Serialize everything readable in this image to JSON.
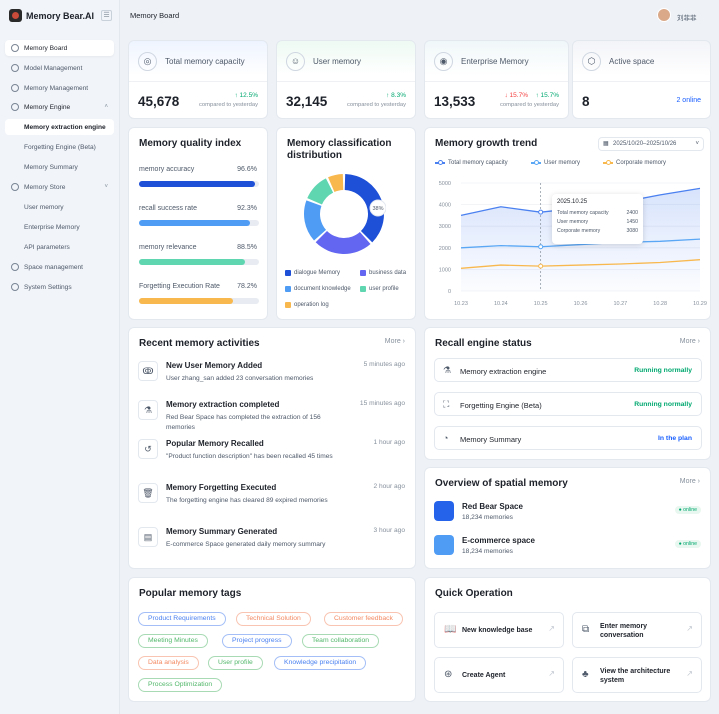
{
  "app": {
    "name": "Memory Bear.AI",
    "page_title": "Memory Board",
    "user": "刘菲菲"
  },
  "sidebar": {
    "items": [
      {
        "label": "Memory Board"
      },
      {
        "label": "Model Management"
      },
      {
        "label": "Memory Management"
      },
      {
        "label": "Memory Engine"
      },
      {
        "label": "Memory extraction engine"
      },
      {
        "label": "Forgetting Engine (Beta)"
      },
      {
        "label": "Memory Summary"
      },
      {
        "label": "Memory Store"
      },
      {
        "label": "User memory"
      },
      {
        "label": "Enterprise Memory"
      },
      {
        "label": "API parameters"
      },
      {
        "label": "Space management"
      },
      {
        "label": "System Settings"
      }
    ]
  },
  "stats": [
    {
      "label": "Total memory capacity",
      "value": "45,678",
      "delta": "↑ 12.5%",
      "compare": "compared to yesterday"
    },
    {
      "label": "User memory",
      "value": "32,145",
      "delta": "↑ 8.3%",
      "compare": "compared to yesterday"
    },
    {
      "label": "Enterprise Memory",
      "value": "13,533",
      "delta_down": "↓ 15.7%",
      "delta_up": "↑ 15.7%",
      "compare": "compared to yesterday"
    },
    {
      "label": "Active space",
      "value": "8",
      "online": "2 online"
    }
  ],
  "quality": {
    "title": "Memory quality index",
    "items": [
      {
        "label": "memory accuracy",
        "value": "96.6%",
        "pct": 96.6,
        "color": "#1d4fd7"
      },
      {
        "label": "recall success rate",
        "value": "92.3%",
        "pct": 92.3,
        "color": "#4f9cf5"
      },
      {
        "label": "memory relevance",
        "value": "88.5%",
        "pct": 88.5,
        "color": "#5fd5b0"
      },
      {
        "label": "Forgetting Execution Rate",
        "value": "78.2%",
        "pct": 78.2,
        "color": "#f8b84e"
      }
    ]
  },
  "classification": {
    "title_line1": "Memory classification",
    "title_line2": "distribution",
    "center_label": "38%",
    "slices": [
      {
        "name": "dialogue Memory",
        "pct": 38,
        "color": "#1d4fd7"
      },
      {
        "name": "business data",
        "pct": 25,
        "color": "#6366f1"
      },
      {
        "name": "document knowledge",
        "pct": 18,
        "color": "#4f9cf5"
      },
      {
        "name": "user profile",
        "pct": 12,
        "color": "#5fd5b0"
      },
      {
        "name": "operation log",
        "pct": 7,
        "color": "#f8b84e"
      }
    ]
  },
  "growth": {
    "title": "Memory growth trend",
    "date_range": "2025/10/20–2025/10/26",
    "tooltip": {
      "date": "2025.10.25",
      "rows": [
        {
          "label": "Total memory capacity",
          "value": "2400"
        },
        {
          "label": "User memory",
          "value": "1450"
        },
        {
          "label": "Corporate memory",
          "value": "3080"
        }
      ]
    }
  },
  "chart_data": {
    "type": "line",
    "x": [
      "10.23",
      "10.24",
      "10.25",
      "10.26",
      "10.27",
      "10.28",
      "10.29"
    ],
    "ylim": [
      0,
      5000
    ],
    "yticks": [
      0,
      1000,
      2000,
      3000,
      4000,
      5000
    ],
    "series": [
      {
        "name": "Total memory capacity",
        "color": "#4a80f0",
        "values": [
          3500,
          3900,
          3650,
          3850,
          4100,
          4450,
          4750
        ]
      },
      {
        "name": "User memory",
        "color": "#5aa7f5",
        "values": [
          2000,
          2100,
          2050,
          2150,
          2250,
          2300,
          2400
        ]
      },
      {
        "name": "Corporate memory",
        "color": "#f8b84e",
        "values": [
          1050,
          1200,
          1150,
          1200,
          1250,
          1320,
          1450
        ]
      }
    ]
  },
  "activities": {
    "title": "Recent memory activities",
    "more": "More ›",
    "items": [
      {
        "icon": "ↂ",
        "title": "New User Memory Added",
        "desc": "User zhang_san added 23 conversation memories",
        "time": "5 minutes ago"
      },
      {
        "icon": "⚗",
        "title": "Memory extraction completed",
        "desc": "Red Bear Space has completed the extraction of 156 memories",
        "time": "15 minutes ago"
      },
      {
        "icon": "↺",
        "title": "Popular Memory Recalled",
        "desc": "\"Product function description\" has been recalled 45 times",
        "time": "1 hour ago"
      },
      {
        "icon": "🗑",
        "title": "Memory Forgetting Executed",
        "desc": "The forgetting engine has cleared 89 expired memories",
        "time": "2 hour ago"
      },
      {
        "icon": "▤",
        "title": "Memory Summary Generated",
        "desc": "E-commerce Space generated daily memory summary",
        "time": "3 hour ago"
      }
    ]
  },
  "recall": {
    "title": "Recall engine status",
    "more": "More ›",
    "items": [
      {
        "icon": "⚗",
        "label": "Memory extraction engine",
        "status": "Running normally",
        "color": "#00a870"
      },
      {
        "icon": "⛶",
        "label": "Forgetting Engine (Beta)",
        "status": "Running normally",
        "color": "#00a870"
      },
      {
        "icon": "◔",
        "label": "Memory Summary",
        "status": "In the plan",
        "color": "#165dff"
      }
    ]
  },
  "spatial": {
    "title": "Overview of spatial memory",
    "more": "More ›",
    "items": [
      {
        "name": "Red Bear Space",
        "sub": "18,234 memories",
        "badge": "● online",
        "color": "#2563eb"
      },
      {
        "name": "E-commerce space",
        "sub": "18,234 memories",
        "badge": "● online",
        "color": "#4f9cf5"
      }
    ]
  },
  "tags": {
    "title": "Popular memory tags",
    "items": [
      {
        "label": "Product Requirements",
        "color": "#4a80f0"
      },
      {
        "label": "Technical Solution",
        "color": "#f38a63"
      },
      {
        "label": "Customer feedback",
        "color": "#f38a63"
      },
      {
        "label": "Meeting Minutes",
        "color": "#52b76a"
      },
      {
        "label": "Project progress",
        "color": "#4a80f0"
      },
      {
        "label": "Team collaboration",
        "color": "#52b76a"
      },
      {
        "label": "Data analysis",
        "color": "#f38a63"
      },
      {
        "label": "User profile",
        "color": "#52b76a"
      },
      {
        "label": "Knowledge precipitation",
        "color": "#4a80f0"
      },
      {
        "label": "Process Optimization",
        "color": "#52b76a"
      }
    ]
  },
  "quick": {
    "title": "Quick Operation",
    "items": [
      {
        "icon": "📖",
        "label": "New knowledge base"
      },
      {
        "icon": "⧉",
        "label": "Enter memory conversation"
      },
      {
        "icon": "⊛",
        "label": "Create Agent"
      },
      {
        "icon": "♣",
        "label": "View the architecture system"
      }
    ],
    "arrow": "↗"
  }
}
